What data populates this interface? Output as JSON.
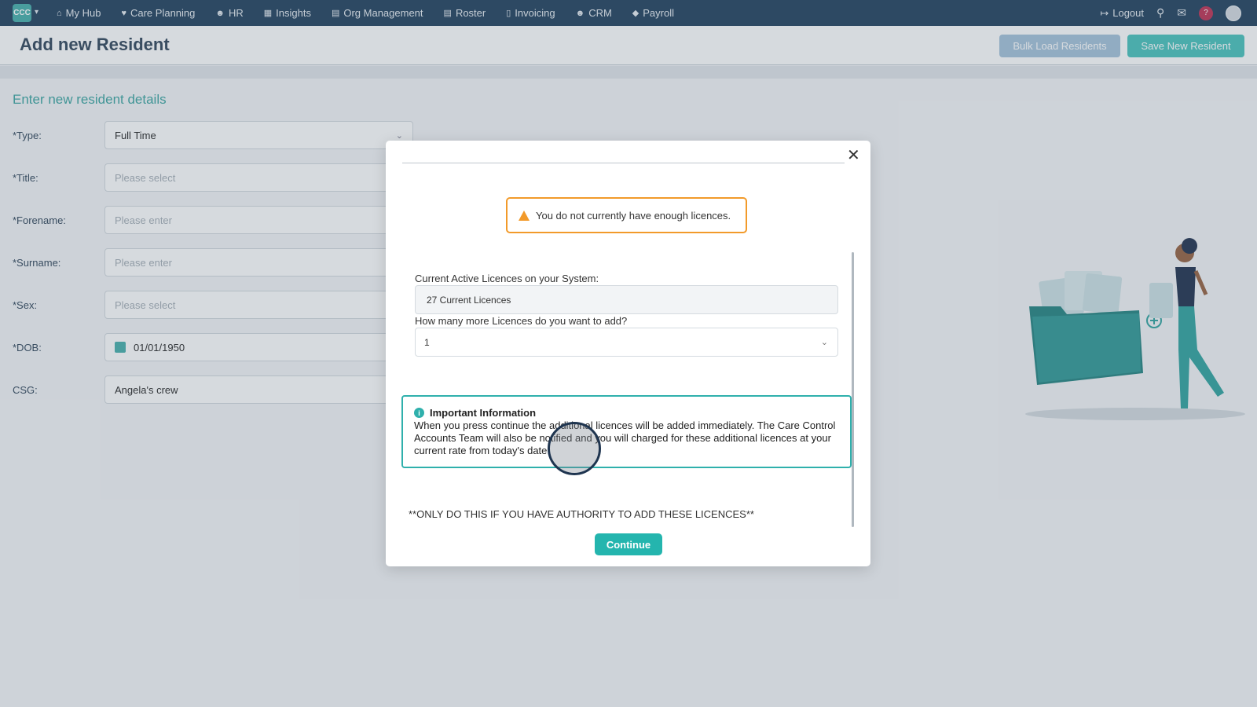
{
  "nav": {
    "logo": "CCC",
    "items": [
      {
        "label": "My Hub",
        "icon": "home-icon"
      },
      {
        "label": "Care Planning",
        "icon": "heart-icon"
      },
      {
        "label": "HR",
        "icon": "people-icon"
      },
      {
        "label": "Insights",
        "icon": "chart-icon"
      },
      {
        "label": "Org Management",
        "icon": "building-icon"
      },
      {
        "label": "Roster",
        "icon": "calendar-icon"
      },
      {
        "label": "Invoicing",
        "icon": "document-icon"
      },
      {
        "label": "CRM",
        "icon": "contacts-icon"
      },
      {
        "label": "Payroll",
        "icon": "tag-icon"
      }
    ],
    "logout": "Logout",
    "help": "?"
  },
  "header": {
    "title": "Add new Resident",
    "bulk_label": "Bulk Load Residents",
    "save_label": "Save New Resident"
  },
  "form": {
    "section_title": "Enter new resident details",
    "rows": [
      {
        "label": "*Type:",
        "value": "Full Time",
        "placeholder": false
      },
      {
        "label": "*Title:",
        "value": "Please select",
        "placeholder": true
      },
      {
        "label": "*Forename:",
        "value": "Please enter",
        "placeholder": true
      },
      {
        "label": "*Surname:",
        "value": "Please enter",
        "placeholder": true
      },
      {
        "label": "*Sex:",
        "value": "Please select",
        "placeholder": true
      },
      {
        "label": "*DOB:",
        "value": "01/01/1950",
        "placeholder": false
      },
      {
        "label": "CSG:",
        "value": "Angela's crew",
        "placeholder": false
      }
    ]
  },
  "modal": {
    "warning": "You do not currently have enough licences.",
    "current_label": "Current Active Licences on your System:",
    "current_value": "27 Current Licences",
    "add_label": "How many more Licences do you want to add?",
    "add_value": "1",
    "info_title": "Important Information",
    "info_body": "When you press continue the additional licences will be added immediately. The Care Control Accounts Team will also be notified and you will charged for these additional licences at your current rate from today's date.",
    "authority": "**ONLY DO THIS IF YOU HAVE AUTHORITY TO ADD THESE LICENCES**",
    "continue_label": "Continue"
  },
  "colors": {
    "nav_bg": "#2c4a66",
    "accent": "#24b5ae",
    "warning": "#f29a2a"
  }
}
